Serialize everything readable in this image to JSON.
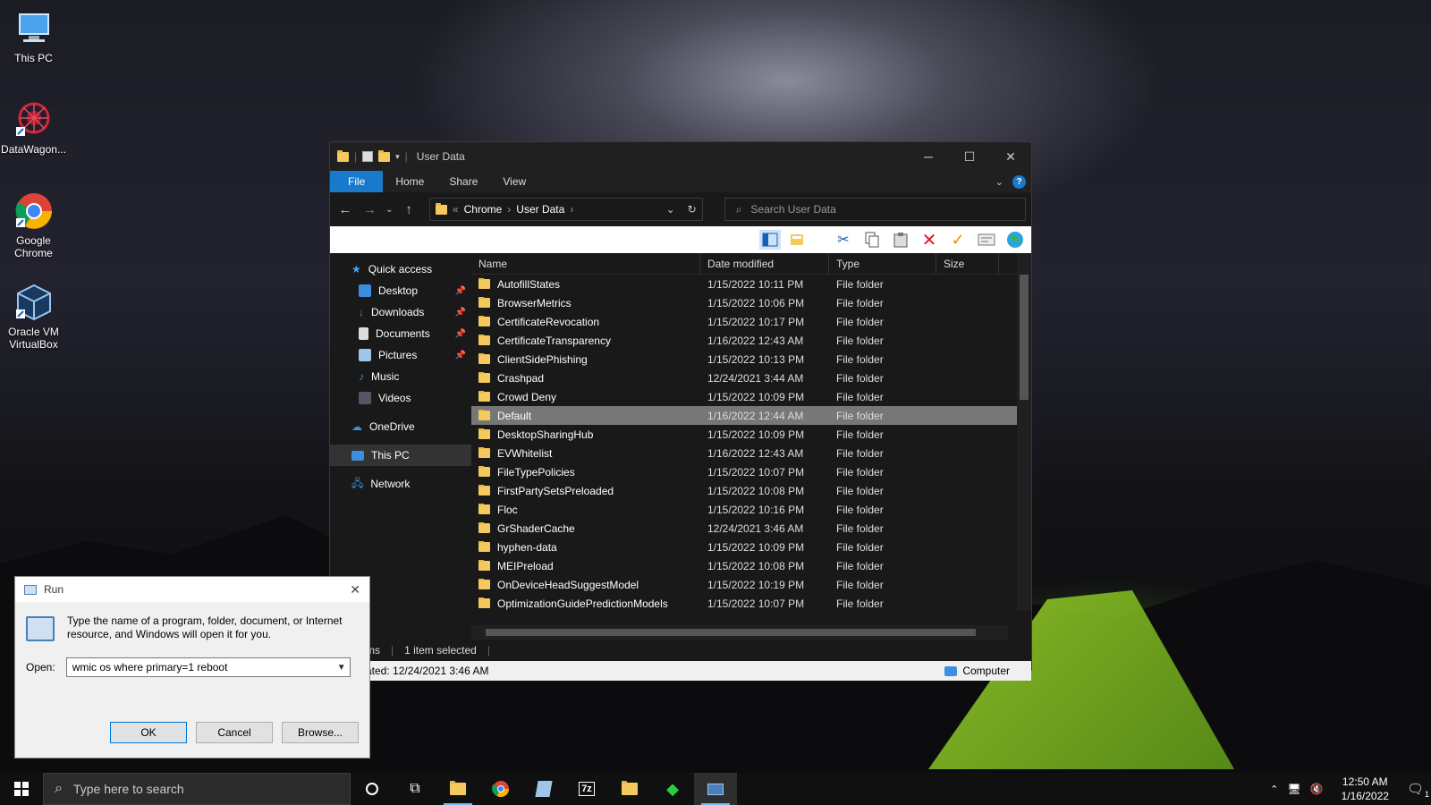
{
  "desktop": {
    "icons": [
      {
        "label": "This PC"
      },
      {
        "label": "DataWagon..."
      },
      {
        "label": "Google Chrome"
      },
      {
        "label": "Oracle VM VirtualBox"
      }
    ]
  },
  "explorer": {
    "title": "User Data",
    "ribbon_tabs": [
      "File",
      "Home",
      "Share",
      "View"
    ],
    "breadcrumb": [
      "Chrome",
      "User Data"
    ],
    "search_placeholder": "Search User Data",
    "columns": [
      "Name",
      "Date modified",
      "Type",
      "Size"
    ],
    "nav": {
      "quick_access": "Quick access",
      "items": [
        "Desktop",
        "Downloads",
        "Documents",
        "Pictures",
        "Music",
        "Videos"
      ],
      "onedrive": "OneDrive",
      "this_pc": "This PC",
      "network": "Network"
    },
    "files": [
      {
        "name": "AutofillStates",
        "date": "1/15/2022 10:11 PM",
        "type": "File folder"
      },
      {
        "name": "BrowserMetrics",
        "date": "1/15/2022 10:06 PM",
        "type": "File folder"
      },
      {
        "name": "CertificateRevocation",
        "date": "1/15/2022 10:17 PM",
        "type": "File folder"
      },
      {
        "name": "CertificateTransparency",
        "date": "1/16/2022 12:43 AM",
        "type": "File folder"
      },
      {
        "name": "ClientSidePhishing",
        "date": "1/15/2022 10:13 PM",
        "type": "File folder"
      },
      {
        "name": "Crashpad",
        "date": "12/24/2021 3:44 AM",
        "type": "File folder"
      },
      {
        "name": "Crowd Deny",
        "date": "1/15/2022 10:09 PM",
        "type": "File folder"
      },
      {
        "name": "Default",
        "date": "1/16/2022 12:44 AM",
        "type": "File folder"
      },
      {
        "name": "DesktopSharingHub",
        "date": "1/15/2022 10:09 PM",
        "type": "File folder"
      },
      {
        "name": "EVWhitelist",
        "date": "1/16/2022 12:43 AM",
        "type": "File folder"
      },
      {
        "name": "FileTypePolicies",
        "date": "1/15/2022 10:07 PM",
        "type": "File folder"
      },
      {
        "name": "FirstPartySetsPreloaded",
        "date": "1/15/2022 10:08 PM",
        "type": "File folder"
      },
      {
        "name": "Floc",
        "date": "1/15/2022 10:16 PM",
        "type": "File folder"
      },
      {
        "name": "GrShaderCache",
        "date": "12/24/2021 3:46 AM",
        "type": "File folder"
      },
      {
        "name": "hyphen-data",
        "date": "1/15/2022 10:09 PM",
        "type": "File folder"
      },
      {
        "name": "MEIPreload",
        "date": "1/15/2022 10:08 PM",
        "type": "File folder"
      },
      {
        "name": "OnDeviceHeadSuggestModel",
        "date": "1/15/2022 10:19 PM",
        "type": "File folder"
      },
      {
        "name": "OptimizationGuidePredictionModels",
        "date": "1/15/2022 10:07 PM",
        "type": "File folder"
      }
    ],
    "selected_index": 7,
    "status": {
      "items": "ms",
      "selected": "1 item selected"
    },
    "details": {
      "created": "ated: 12/24/2021 3:46 AM",
      "location": "Computer"
    }
  },
  "run_dialog": {
    "title": "Run",
    "description": "Type the name of a program, folder, document, or Internet resource, and Windows will open it for you.",
    "open_label": "Open:",
    "open_value": "wmic os where primary=1 reboot",
    "ok": "OK",
    "cancel": "Cancel",
    "browse": "Browse..."
  },
  "taskbar": {
    "search_placeholder": "Type here to search",
    "time": "12:50 AM",
    "date": "1/16/2022",
    "notification_count": "1"
  }
}
